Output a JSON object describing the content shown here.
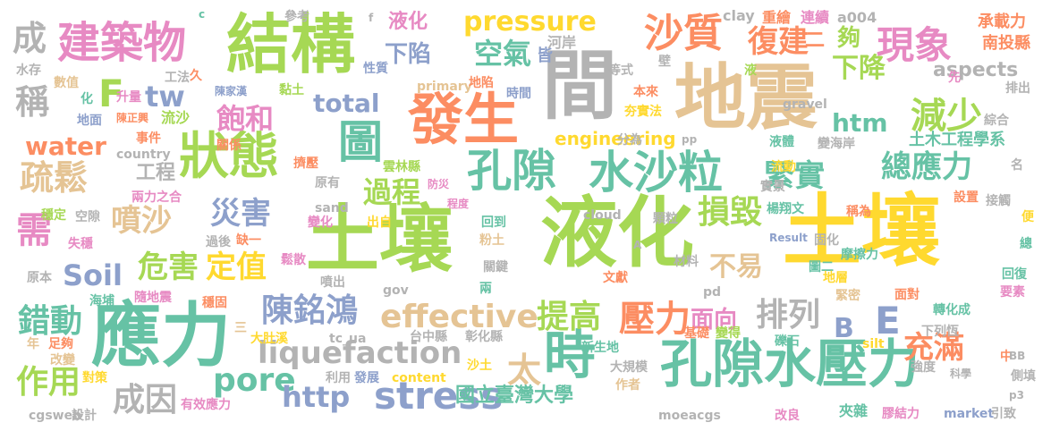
{
  "words": [
    {
      "text": "土壤",
      "color": "#ffd92f"
    },
    {
      "text": "液化",
      "color": "#a6d854"
    },
    {
      "text": "地震",
      "color": "#e5c494"
    },
    {
      "text": "土壤",
      "color": "#a6d854"
    },
    {
      "text": "結構",
      "color": "#a6d854"
    },
    {
      "text": "間",
      "color": "#b3b3b3"
    },
    {
      "text": "應力",
      "color": "#66c2a5"
    },
    {
      "text": "孔隙水壓力",
      "color": "#66c2a5"
    },
    {
      "text": "發生",
      "color": "#fc8d62"
    },
    {
      "text": "建築物",
      "color": "#e78ac3"
    },
    {
      "text": "狀態",
      "color": "#a6d854"
    },
    {
      "text": "孔隙",
      "color": "#66c2a5"
    },
    {
      "text": "水沙粒",
      "color": "#66c2a5"
    },
    {
      "text": "時",
      "color": "#66c2a5"
    },
    {
      "text": "沙質",
      "color": "#fc8d62"
    },
    {
      "text": "stress",
      "color": "#8da0cb"
    },
    {
      "text": "effective",
      "color": "#e5c494"
    },
    {
      "text": "liquefaction",
      "color": "#b3b3b3"
    },
    {
      "text": "pressure",
      "color": "#ffd92f"
    },
    {
      "text": "陳銘鴻",
      "color": "#8da0cb"
    },
    {
      "text": "提高",
      "color": "#a6d854"
    },
    {
      "text": "壓力",
      "color": "#fc8d62"
    },
    {
      "text": "排列",
      "color": "#b3b3b3"
    },
    {
      "text": "圖",
      "color": "#66c2a5"
    },
    {
      "text": "減少",
      "color": "#a6d854"
    },
    {
      "text": "現象",
      "color": "#e78ac3"
    },
    {
      "text": "總應力",
      "color": "#66c2a5"
    },
    {
      "text": "緊實",
      "color": "#66c2a5"
    },
    {
      "text": "疏鬆",
      "color": "#e5c494"
    },
    {
      "text": "噴沙",
      "color": "#e5c494"
    },
    {
      "text": "災害",
      "color": "#8da0cb"
    },
    {
      "text": "危害",
      "color": "#a6d854"
    },
    {
      "text": "定值",
      "color": "#ffd92f"
    },
    {
      "text": "錯動",
      "color": "#66c2a5"
    },
    {
      "text": "成因",
      "color": "#b3b3b3"
    },
    {
      "text": "作用",
      "color": "#a6d854"
    },
    {
      "text": "充滿",
      "color": "#fc8d62"
    },
    {
      "text": "復建",
      "color": "#fc8d62"
    },
    {
      "text": "空氣",
      "color": "#66c2a5"
    },
    {
      "text": "下陷",
      "color": "#8da0cb"
    },
    {
      "text": "過程",
      "color": "#a6d854"
    },
    {
      "text": "損毀",
      "color": "#a6d854"
    },
    {
      "text": "飽和",
      "color": "#e78ac3"
    },
    {
      "text": "需",
      "color": "#e78ac3"
    },
    {
      "text": "稱",
      "color": "#b3b3b3"
    },
    {
      "text": "成",
      "color": "#b3b3b3"
    },
    {
      "text": "太",
      "color": "#e5c494"
    },
    {
      "text": "E",
      "color": "#8da0cb"
    },
    {
      "text": "B",
      "color": "#8da0cb"
    },
    {
      "text": "F",
      "color": "#a6d854"
    },
    {
      "text": "tw",
      "color": "#8da0cb"
    },
    {
      "text": "Soil",
      "color": "#8da0cb"
    },
    {
      "text": "pore",
      "color": "#66c2a5"
    },
    {
      "text": "http",
      "color": "#8da0cb"
    },
    {
      "text": "water",
      "color": "#fc8d62"
    },
    {
      "text": "total",
      "color": "#8da0cb"
    },
    {
      "text": "htm",
      "color": "#66c2a5"
    },
    {
      "text": "engineering",
      "color": "#ffd92f"
    },
    {
      "text": "aspects",
      "color": "#b3b3b3"
    },
    {
      "text": "不易",
      "color": "#e5c494"
    },
    {
      "text": "面向",
      "color": "#e78ac3"
    },
    {
      "text": "下降",
      "color": "#a6d854"
    },
    {
      "text": "夠",
      "color": "#a6d854"
    },
    {
      "text": "土木工程學系",
      "color": "#66c2a5"
    },
    {
      "text": "國立臺灣大學",
      "color": "#66c2a5"
    },
    {
      "text": "工程",
      "color": "#b3b3b3"
    },
    {
      "text": "液化",
      "color": "#e78ac3"
    },
    {
      "text": "承載力",
      "color": "#fc8d62"
    },
    {
      "text": "南投縣",
      "color": "#fc8d62"
    },
    {
      "text": "重繪",
      "color": "#fc8d62"
    },
    {
      "text": "連續",
      "color": "#e78ac3"
    },
    {
      "text": "a004",
      "color": "#b3b3b3"
    },
    {
      "text": "clay",
      "color": "#b3b3b3"
    },
    {
      "text": "二",
      "color": "#fc8d62"
    },
    {
      "text": "河岸",
      "color": "#b3b3b3"
    },
    {
      "text": "皆",
      "color": "#8da0cb"
    },
    {
      "text": "性質",
      "color": "#8da0cb"
    },
    {
      "text": "水存",
      "color": "#b3b3b3"
    },
    {
      "text": "數值",
      "color": "#e5c494"
    },
    {
      "text": "工法",
      "color": "#b3b3b3"
    },
    {
      "text": "久",
      "color": "#fc8d62"
    },
    {
      "text": "升量",
      "color": "#e78ac3"
    },
    {
      "text": "化",
      "color": "#66c2a5"
    },
    {
      "text": "陳家漢",
      "color": "#8da0cb"
    },
    {
      "text": "黏土",
      "color": "#a6d854"
    },
    {
      "text": "地面",
      "color": "#8da0cb"
    },
    {
      "text": "陳正興",
      "color": "#fc8d62"
    },
    {
      "text": "流沙",
      "color": "#a6d854"
    },
    {
      "text": "關係",
      "color": "#fc8d62"
    },
    {
      "text": "事件",
      "color": "#fc8d62"
    },
    {
      "text": "country",
      "color": "#b3b3b3"
    },
    {
      "text": "擠壓",
      "color": "#fc8d62"
    },
    {
      "text": "雲林縣",
      "color": "#a6d854"
    },
    {
      "text": "防災",
      "color": "#e78ac3"
    },
    {
      "text": "兩力之合",
      "color": "#e78ac3"
    },
    {
      "text": "穩定",
      "color": "#a6d854"
    },
    {
      "text": "空隙",
      "color": "#b3b3b3"
    },
    {
      "text": "sand",
      "color": "#b3b3b3"
    },
    {
      "text": "變化",
      "color": "#e78ac3"
    },
    {
      "text": "出自",
      "color": "#ffd92f"
    },
    {
      "text": "回到",
      "color": "#66c2a5"
    },
    {
      "text": "程度",
      "color": "#e78ac3"
    },
    {
      "text": "cloud",
      "color": "#b3b3b3"
    },
    {
      "text": "顆粒",
      "color": "#b3b3b3"
    },
    {
      "text": "楊翔文",
      "color": "#66c2a5"
    },
    {
      "text": "稱為",
      "color": "#fc8d62"
    },
    {
      "text": "接觸",
      "color": "#b3b3b3"
    },
    {
      "text": "失穩",
      "color": "#e78ac3"
    },
    {
      "text": "過後",
      "color": "#b3b3b3"
    },
    {
      "text": "缺一",
      "color": "#fc8d62"
    },
    {
      "text": "粉土",
      "color": "#e5c494"
    },
    {
      "text": "鬆散",
      "color": "#e78ac3"
    },
    {
      "text": "Result",
      "color": "#8da0cb"
    },
    {
      "text": "固化",
      "color": "#b3b3b3"
    },
    {
      "text": "摩擦力",
      "color": "#66c2a5"
    },
    {
      "text": "原本",
      "color": "#b3b3b3"
    },
    {
      "text": "海埔",
      "color": "#66c2a5"
    },
    {
      "text": "隨地震",
      "color": "#e78ac3"
    },
    {
      "text": "噴出",
      "color": "#b3b3b3"
    },
    {
      "text": "關鍵",
      "color": "#b3b3b3"
    },
    {
      "text": "材料",
      "color": "#b3b3b3"
    },
    {
      "text": "圖二",
      "color": "#66c2a5"
    },
    {
      "text": "地層",
      "color": "#ffd92f"
    },
    {
      "text": "回復",
      "color": "#66c2a5"
    },
    {
      "text": "要素",
      "color": "#e78ac3"
    },
    {
      "text": "gov",
      "color": "#b3b3b3"
    },
    {
      "text": "兩",
      "color": "#66c2a5"
    },
    {
      "text": "文獻",
      "color": "#fc8d62"
    },
    {
      "text": "pd",
      "color": "#b3b3b3"
    },
    {
      "text": "緊密",
      "color": "#e5c494"
    },
    {
      "text": "面對",
      "color": "#fc8d62"
    },
    {
      "text": "穩固",
      "color": "#fc8d62"
    },
    {
      "text": "轉化成",
      "color": "#66c2a5"
    },
    {
      "text": "下列恆",
      "color": "#b3b3b3"
    },
    {
      "text": "大肚溪",
      "color": "#ffd92f"
    },
    {
      "text": "tc_ua",
      "color": "#b3b3b3"
    },
    {
      "text": "台中縣",
      "color": "#b3b3b3"
    },
    {
      "text": "彰化縣",
      "color": "#b3b3b3"
    },
    {
      "text": "基礎",
      "color": "#fc8d62"
    },
    {
      "text": "變得",
      "color": "#a6d854"
    },
    {
      "text": "礫石",
      "color": "#66c2a5"
    },
    {
      "text": "新生地",
      "color": "#66c2a5"
    },
    {
      "text": "足夠",
      "color": "#fc8d62"
    },
    {
      "text": "改變",
      "color": "#e5c494"
    },
    {
      "text": "對策",
      "color": "#ffd92f"
    },
    {
      "text": "沙土",
      "color": "#ffd92f"
    },
    {
      "text": "大規模",
      "color": "#b3b3b3"
    },
    {
      "text": "利用",
      "color": "#b3b3b3"
    },
    {
      "text": "發展",
      "color": "#8da0cb"
    },
    {
      "text": "content",
      "color": "#ffd92f"
    },
    {
      "text": "作者",
      "color": "#e5c494"
    },
    {
      "text": "silt",
      "color": "#ffd92f"
    },
    {
      "text": "強度",
      "color": "#b3b3b3"
    },
    {
      "text": "科學",
      "color": "#b3b3b3"
    },
    {
      "text": "側填",
      "color": "#b3b3b3"
    },
    {
      "text": "有效應力",
      "color": "#e78ac3"
    },
    {
      "text": "cgsweb",
      "color": "#b3b3b3"
    },
    {
      "text": "設計",
      "color": "#b3b3b3"
    },
    {
      "text": "moeacgs",
      "color": "#b3b3b3"
    },
    {
      "text": "改良",
      "color": "#e78ac3"
    },
    {
      "text": "夾雜",
      "color": "#66c2a5"
    },
    {
      "text": "膠結力",
      "color": "#e78ac3"
    },
    {
      "text": "market",
      "color": "#8da0cb"
    },
    {
      "text": "引致",
      "color": "#b3b3b3"
    },
    {
      "text": "p3",
      "color": "#b3b3b3"
    },
    {
      "text": "primary",
      "color": "#e5c494"
    },
    {
      "text": "地陷",
      "color": "#fc8d62"
    },
    {
      "text": "時間",
      "color": "#8da0cb"
    },
    {
      "text": "本來",
      "color": "#fc8d62"
    },
    {
      "text": "夯實法",
      "color": "#ffd92f"
    },
    {
      "text": "gravel",
      "color": "#b3b3b3"
    },
    {
      "text": "pp",
      "color": "#b3b3b3"
    },
    {
      "text": "液體",
      "color": "#66c2a5"
    },
    {
      "text": "變海岸",
      "color": "#b3b3b3"
    },
    {
      "text": "流動",
      "color": "#ffd92f"
    },
    {
      "text": "實景",
      "color": "#b3b3b3"
    },
    {
      "text": "分為",
      "color": "#b3b3b3"
    },
    {
      "text": "綜合",
      "color": "#b3b3b3"
    },
    {
      "text": "排出",
      "color": "#b3b3b3"
    },
    {
      "text": "設置",
      "color": "#fc8d62"
    },
    {
      "text": "參考",
      "color": "#b3b3b3"
    },
    {
      "text": "等式",
      "color": "#b3b3b3"
    },
    {
      "text": "原有",
      "color": "#b3b3b3"
    },
    {
      "text": "名",
      "color": "#b3b3b3"
    },
    {
      "text": "便",
      "color": "#ffd92f"
    },
    {
      "text": "總",
      "color": "#66c2a5"
    },
    {
      "text": "中",
      "color": "#fc8d62"
    },
    {
      "text": "壁",
      "color": "#b3b3b3"
    },
    {
      "text": "液",
      "color": "#a6d854"
    },
    {
      "text": "先",
      "color": "#e78ac3"
    },
    {
      "text": "c",
      "color": "#66c2a5"
    },
    {
      "text": "f",
      "color": "#b3b3b3"
    },
    {
      "text": "A",
      "color": "#b3b3b3"
    },
    {
      "text": "三",
      "color": "#e5c494"
    },
    {
      "text": "BB",
      "color": "#b3b3b3"
    },
    {
      "text": "年",
      "color": "#e5c494"
    }
  ]
}
